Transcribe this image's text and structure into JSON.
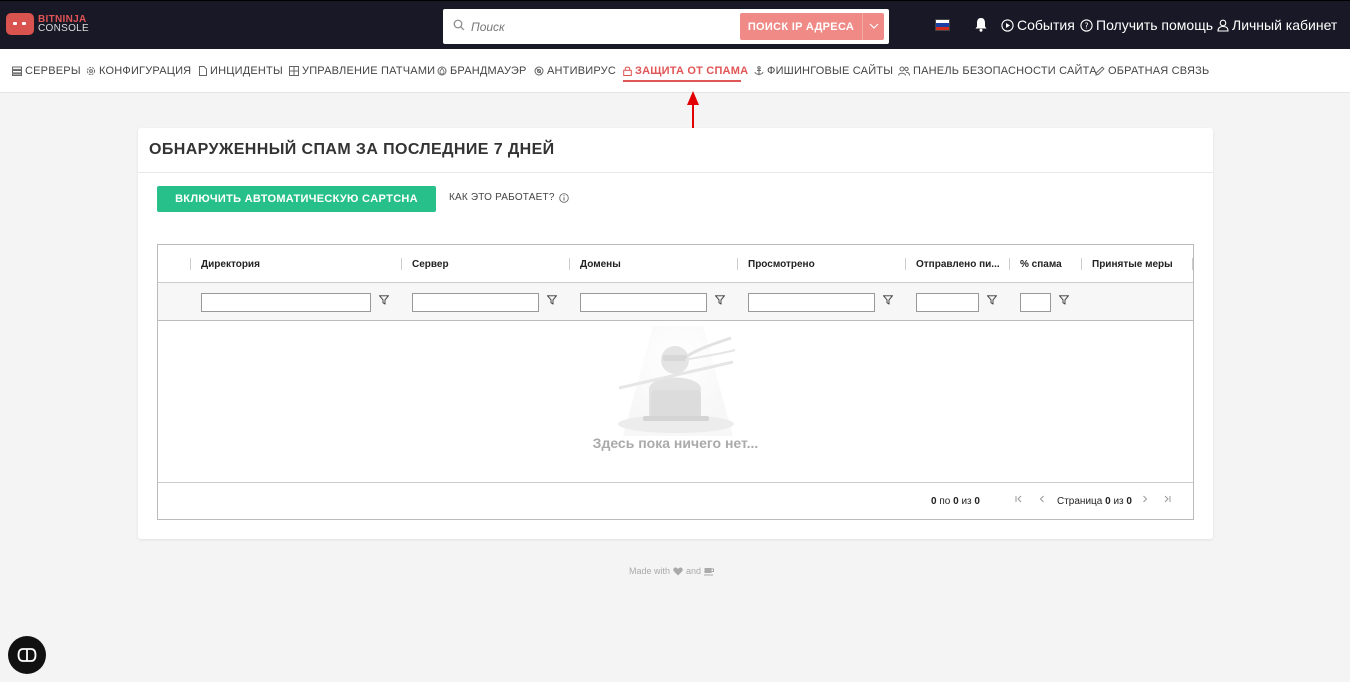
{
  "logo": {
    "line1": "BITNINJA",
    "line2": "CONSOLE"
  },
  "topbar": {
    "search_placeholder": "Поиск",
    "ip_search_label": "ПОИСК IP АДРЕСА",
    "events_label": "События",
    "help_label": "Получить помощь",
    "account_label": "Личный кабинет",
    "flag_colors": [
      "#ffffff",
      "#1c3fa6",
      "#d52b1e"
    ]
  },
  "nav": {
    "items": [
      {
        "label": "СЕРВЕРЫ",
        "icon": "servers-icon"
      },
      {
        "label": "КОНФИГУРАЦИЯ",
        "icon": "gear-icon"
      },
      {
        "label": "ИНЦИДЕНТЫ",
        "icon": "document-icon"
      },
      {
        "label": "УПРАВЛЕНИЕ ПАТЧАМИ",
        "icon": "grid-icon"
      },
      {
        "label": "БРАНДМАУЭР",
        "icon": "firewall-icon"
      },
      {
        "label": "АНТИВИРУС",
        "icon": "virus-icon"
      },
      {
        "label": "ЗАЩИТА ОТ СПАМА",
        "icon": "lock-icon"
      },
      {
        "label": "ФИШИНГОВЫЕ САЙТЫ",
        "icon": "anchor-icon"
      },
      {
        "label": "ПАНЕЛЬ БЕЗОПАСНОСТИ САЙТА",
        "icon": "users-icon"
      },
      {
        "label": "ОБРАТНАЯ СВЯЗЬ",
        "icon": "pencil-icon"
      }
    ],
    "active_index": 6,
    "accent_color": "#e05555"
  },
  "card": {
    "title": "ОБНАРУЖЕННЫЙ СПАМ ЗА ПОСЛЕДНИЕ 7 ДНЕЙ",
    "captcha_button": "ВКЛЮЧИТЬ АВТОМАТИЧЕСКУЮ CAPTCHA",
    "how_it_works": "КАК ЭТО РАБОТАЕТ?",
    "button_color": "#27c08b"
  },
  "grid": {
    "columns": [
      "Директория",
      "Сервер",
      "Домены",
      "Просмотрено",
      "Отправлено пи...",
      "% спама",
      "Принятые меры"
    ],
    "empty_text": "Здесь пока ничего нет...",
    "rows_info": {
      "from": "0",
      "to_word": "по",
      "to": "0",
      "of_word": "из",
      "total": "0"
    },
    "page_info": {
      "page_word": "Страница",
      "page": "0",
      "of_word": "из",
      "pages": "0"
    }
  },
  "footer": {
    "made_with": "Made with",
    "and": "and"
  }
}
